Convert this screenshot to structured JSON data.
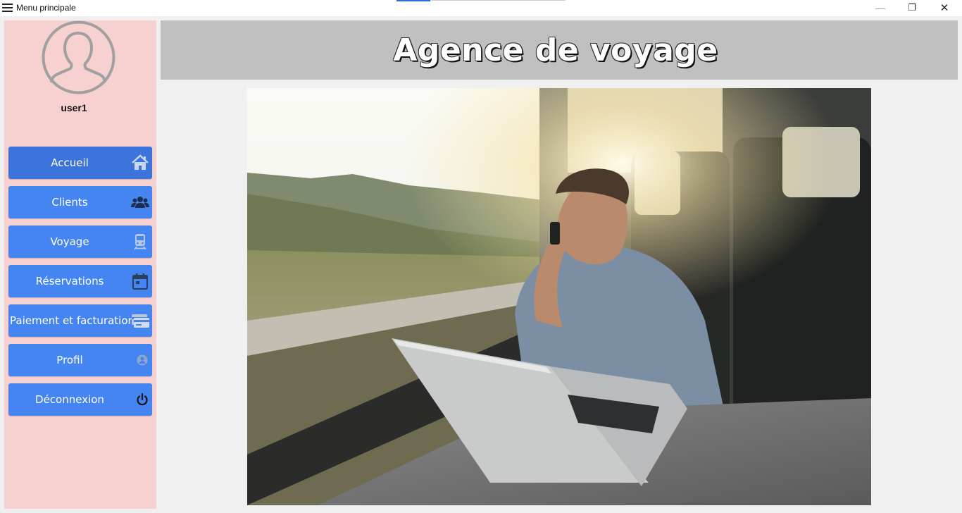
{
  "window": {
    "title": "Menu principale",
    "controls": {
      "minimize": "—",
      "maximize": "❐",
      "close": "✕"
    }
  },
  "user": {
    "name": "user1",
    "avatar_icon": "user-silhouette-icon"
  },
  "nav": {
    "items": [
      {
        "label": "Accueil",
        "icon": "home-icon",
        "active": true
      },
      {
        "label": "Clients",
        "icon": "users-icon",
        "active": false
      },
      {
        "label": "Voyage",
        "icon": "train-icon",
        "active": false
      },
      {
        "label": "Réservations",
        "icon": "calendar-icon",
        "active": false
      },
      {
        "label": "Paiement et facturation",
        "icon": "credit-card-icon",
        "active": false
      },
      {
        "label": "Profil",
        "icon": "user-circle-icon",
        "active": false
      },
      {
        "label": "Déconnexion",
        "icon": "power-icon",
        "active": false
      }
    ]
  },
  "header": {
    "title": "Agence de voyage"
  },
  "colors": {
    "sidebar_bg": "#f7d0d0",
    "button_bg": "#4585f2",
    "button_active_bg": "#3d74dc",
    "banner_bg": "#c0c0c0",
    "page_bg": "#f0f0f0"
  }
}
